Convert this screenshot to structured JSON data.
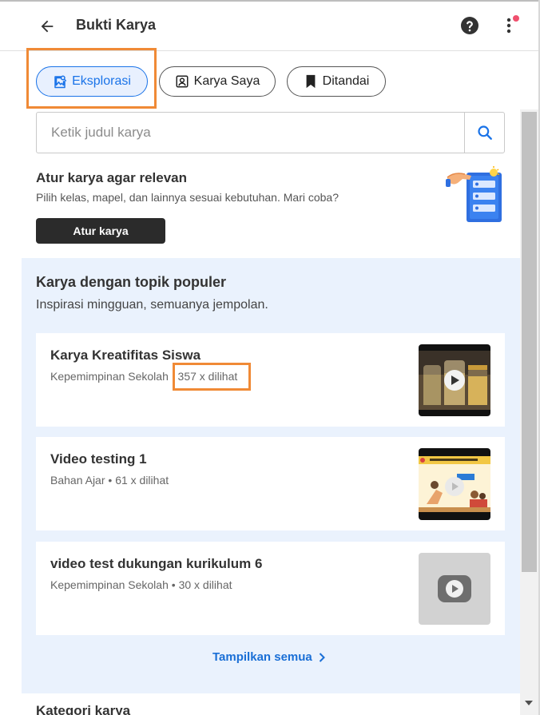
{
  "header": {
    "title": "Bukti Karya"
  },
  "tabs": [
    {
      "label": "Eksplorasi",
      "icon": "image-search-icon",
      "active": true
    },
    {
      "label": "Karya Saya",
      "icon": "portrait-icon",
      "active": false
    },
    {
      "label": "Ditandai",
      "icon": "bookmark-icon",
      "active": false
    }
  ],
  "search": {
    "placeholder": "Ketik judul karya"
  },
  "atur": {
    "title": "Atur karya agar relevan",
    "subtitle": "Pilih kelas, mapel, dan lainnya sesuai kebutuhan. Mari coba?",
    "button_label": "Atur karya"
  },
  "popular": {
    "title": "Karya dengan topik populer",
    "subtitle": "Inspirasi mingguan, semuanya jempolan.",
    "items": [
      {
        "title": "Karya Kreatifitas Siswa",
        "category": "Kepemimpinan Sekolah",
        "views": "357 x dilihat"
      },
      {
        "title": "Video testing 1",
        "category": "Bahan Ajar",
        "views": "61 x dilihat"
      },
      {
        "title": "video test dukungan kurikulum 6",
        "category": "Kepemimpinan Sekolah",
        "views": "30 x dilihat"
      }
    ],
    "show_all_label": "Tampilkan semua"
  },
  "categories": {
    "title": "Kategori karya"
  },
  "colors": {
    "accent": "#1a73e8",
    "highlight": "#f08a36",
    "section_bg": "#eaf2fd",
    "notification": "#f0506e"
  }
}
